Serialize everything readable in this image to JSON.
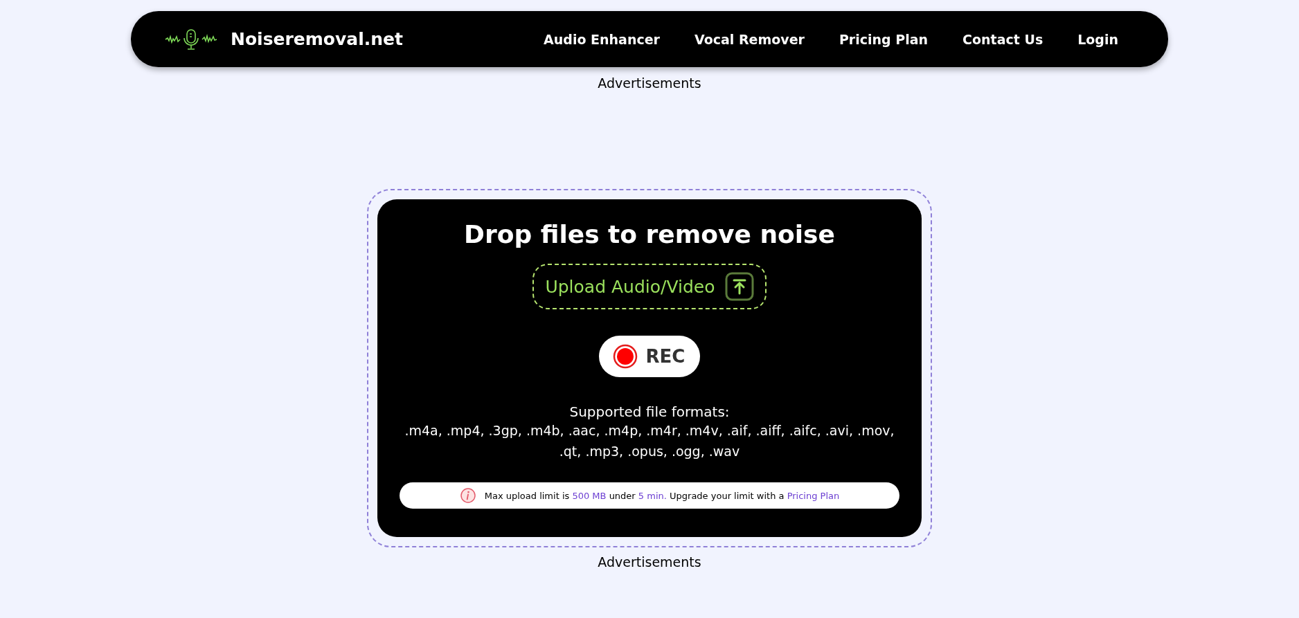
{
  "header": {
    "brand": "Noiseremoval.net",
    "nav": [
      {
        "label": "Audio Enhancer"
      },
      {
        "label": "Vocal Remover"
      },
      {
        "label": "Pricing Plan"
      },
      {
        "label": "Contact Us"
      },
      {
        "label": "Login"
      }
    ]
  },
  "ad_top": "Advertisements",
  "upload": {
    "title": "Drop files to remove noise",
    "upload_button": "Upload Audio/Video",
    "rec_button": "REC",
    "formats_label": "Supported file formats:",
    "formats": ".m4a, .mp4, .3gp, .m4b, .aac, .m4p, .m4r, .m4v, .aif, .aiff, .aifc, .avi, .mov, .qt, .mp3, .opus, .ogg, .wav",
    "notice": [
      {
        "kind": "plain",
        "text": "Max upload limit is "
      },
      {
        "kind": "highlight",
        "text": "500 MB"
      },
      {
        "kind": "plain",
        "text": " under "
      },
      {
        "kind": "highlight",
        "text": "5 min."
      },
      {
        "kind": "plain",
        "text": " Upgrade your limit with a "
      },
      {
        "kind": "link",
        "text": "Pricing Plan"
      }
    ]
  },
  "ad_bottom": "Advertisements"
}
